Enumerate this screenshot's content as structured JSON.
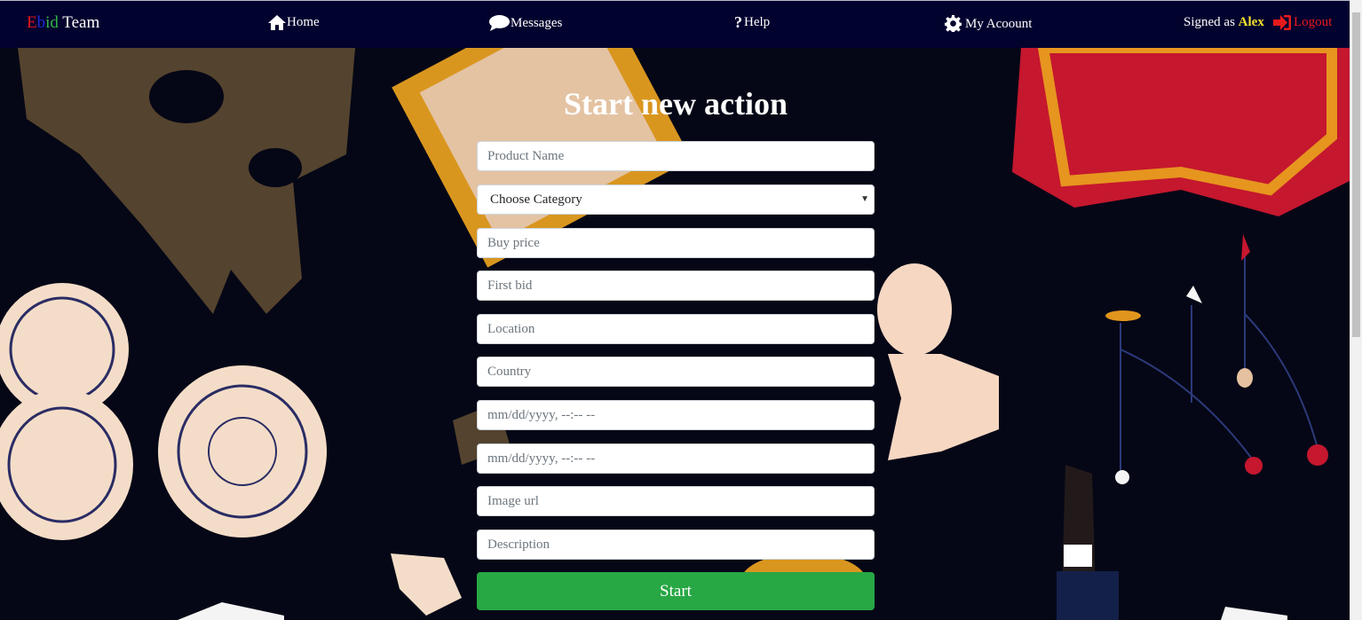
{
  "brand": {
    "letter_e": "E",
    "letter_b": "b",
    "letter_i": "i",
    "letter_d": "d",
    "team": " Team"
  },
  "nav": {
    "home": "Home",
    "messages": "Messages",
    "help": "Help",
    "account": "My Acoount",
    "signed_prefix": "Signed as ",
    "user": "Alex",
    "logout": "Logout"
  },
  "form": {
    "title": "Start new action",
    "product_name_placeholder": "Product Name",
    "category_selected": "Choose Category",
    "buy_price_placeholder": "Buy price",
    "first_bid_placeholder": "First bid",
    "location_placeholder": "Location",
    "country_placeholder": "Country",
    "start_date_placeholder": "mm/dd/yyyy, --:-- --",
    "end_date_placeholder": "mm/dd/yyyy, --:-- --",
    "image_url_placeholder": "Image url",
    "description_placeholder": "Description",
    "submit_label": "Start"
  },
  "colors": {
    "navbar": "#02022f",
    "background": "#050716",
    "submit": "#28a745",
    "user_highlight": "#f4e22a",
    "logout": "#e61b1b"
  },
  "icons": [
    "home-icon",
    "chat-bubble-icon",
    "question-icon",
    "gear-icon",
    "sign-out-icon"
  ]
}
